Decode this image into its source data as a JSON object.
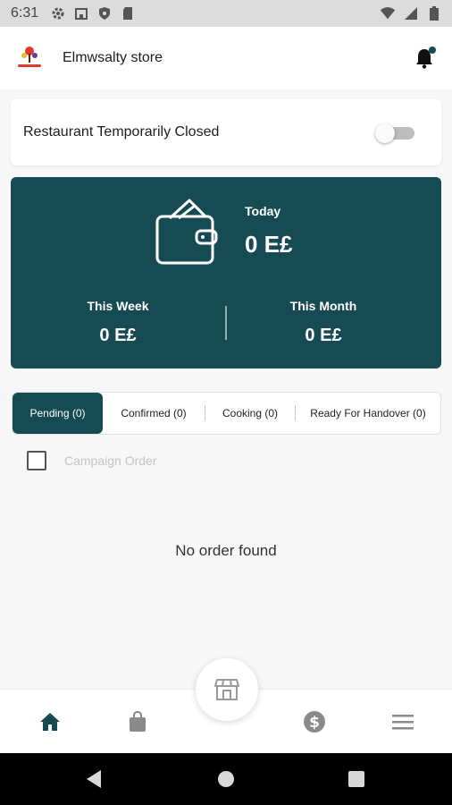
{
  "status_bar": {
    "time": "6:31",
    "left_icons": [
      "settings-icon",
      "store-icon",
      "shield-icon",
      "sd-card-icon"
    ],
    "right_icons": [
      "wifi-icon",
      "cellular-icon",
      "battery-icon"
    ]
  },
  "app_bar": {
    "store_name": "Elmwsalty store",
    "has_notification_dot": true
  },
  "closed_card": {
    "label": "Restaurant Temporarily Closed",
    "toggle_on": false
  },
  "earnings": {
    "today_label": "Today",
    "today_value": "0 E£",
    "week_label": "This Week",
    "week_value": "0 E£",
    "month_label": "This Month",
    "month_value": "0 E£"
  },
  "tabs": [
    {
      "label": "Pending (0)",
      "active": true
    },
    {
      "label": "Confirmed (0)",
      "active": false
    },
    {
      "label": "Cooking (0)",
      "active": false
    },
    {
      "label": "Ready For Handover (0)",
      "active": false
    }
  ],
  "campaign": {
    "label": "Campaign Order",
    "checked": false
  },
  "empty_message": "No order found",
  "bottom_nav": [
    "home-icon",
    "orders-bag-icon",
    "store-icon",
    "dollar-icon",
    "menu-icon"
  ],
  "colors": {
    "primary": "#174b54",
    "background": "#f7f7f7",
    "nav_inactive": "#8a8a8a"
  }
}
